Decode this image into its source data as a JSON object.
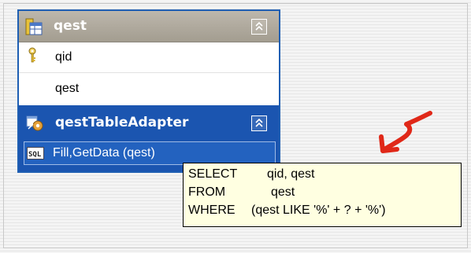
{
  "table": {
    "name": "qest",
    "columns": [
      {
        "name": "qid",
        "primary_key": true
      },
      {
        "name": "qest",
        "primary_key": false
      }
    ]
  },
  "adapter": {
    "name": "qestTableAdapter",
    "methods": [
      {
        "label": "Fill,GetData (qest)"
      }
    ]
  },
  "tooltip": {
    "lines": [
      {
        "keyword": "SELECT",
        "text": "qid, qest"
      },
      {
        "keyword": "FROM",
        "text": "qest"
      },
      {
        "keyword": "WHERE",
        "text": "(qest LIKE '%' + ? + '%')"
      }
    ]
  },
  "colors": {
    "adapter_blue": "#1b55b0",
    "header_gray": "#a39d90",
    "tooltip_bg": "#ffffe1",
    "arrow_red": "#e02818"
  },
  "icons": {
    "table": "table-icon",
    "key": "key-icon",
    "adapter": "table-adapter-icon",
    "sql": "sql-icon",
    "collapse": "collapse-chevron-icon",
    "annotation": "red-arrow-icon"
  }
}
